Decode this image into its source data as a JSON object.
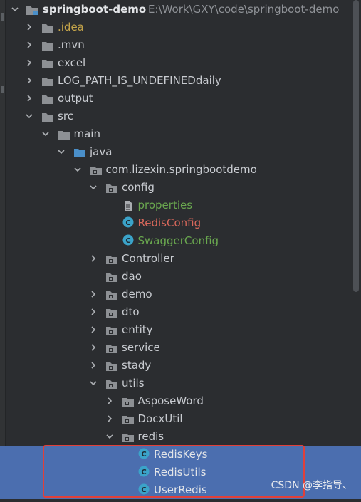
{
  "project": {
    "name": "springboot-demo",
    "path": "E:\\Work\\GXY\\code\\springboot-demo"
  },
  "tree": [
    {
      "label": ".idea",
      "kind": "folder",
      "color": "yellow",
      "arrow": "collapsed"
    },
    {
      "label": ".mvn",
      "kind": "folder",
      "color": "default",
      "arrow": "collapsed"
    },
    {
      "label": "excel",
      "kind": "folder",
      "color": "default",
      "arrow": "collapsed"
    },
    {
      "label": "LOG_PATH_IS_UNDEFINEDdaily",
      "kind": "folder",
      "color": "default",
      "arrow": "collapsed"
    },
    {
      "label": "output",
      "kind": "folder",
      "color": "default",
      "arrow": "collapsed"
    },
    {
      "label": "src",
      "kind": "folder",
      "color": "default",
      "arrow": "expanded"
    },
    {
      "label": "main",
      "kind": "folder",
      "color": "default",
      "arrow": "expanded"
    },
    {
      "label": "java",
      "kind": "source-folder",
      "color": "default",
      "arrow": "expanded"
    },
    {
      "label": "com.lizexin.springbootdemo",
      "kind": "package",
      "color": "default",
      "arrow": "expanded"
    },
    {
      "label": "config",
      "kind": "package",
      "color": "default",
      "arrow": "expanded"
    },
    {
      "label": "properties",
      "kind": "file",
      "color": "green",
      "arrow": "none"
    },
    {
      "label": "RedisConfig",
      "kind": "class",
      "color": "red",
      "arrow": "none"
    },
    {
      "label": "SwaggerConfig",
      "kind": "class",
      "color": "green",
      "arrow": "none"
    },
    {
      "label": "Controller",
      "kind": "package",
      "color": "default",
      "arrow": "collapsed"
    },
    {
      "label": "dao",
      "kind": "package",
      "color": "default",
      "arrow": "none"
    },
    {
      "label": "demo",
      "kind": "package",
      "color": "default",
      "arrow": "collapsed"
    },
    {
      "label": "dto",
      "kind": "package",
      "color": "default",
      "arrow": "collapsed"
    },
    {
      "label": "entity",
      "kind": "package",
      "color": "default",
      "arrow": "collapsed"
    },
    {
      "label": "service",
      "kind": "package",
      "color": "default",
      "arrow": "collapsed"
    },
    {
      "label": "stady",
      "kind": "package",
      "color": "default",
      "arrow": "collapsed"
    },
    {
      "label": "utils",
      "kind": "package",
      "color": "default",
      "arrow": "expanded"
    },
    {
      "label": "AsposeWord",
      "kind": "package",
      "color": "default",
      "arrow": "collapsed"
    },
    {
      "label": "DocxUtil",
      "kind": "package",
      "color": "default",
      "arrow": "collapsed"
    },
    {
      "label": "redis",
      "kind": "package",
      "color": "default",
      "arrow": "expanded"
    },
    {
      "label": "RedisKeys",
      "kind": "class",
      "color": "white",
      "arrow": "none",
      "selected": true
    },
    {
      "label": "RedisUtils",
      "kind": "class",
      "color": "white",
      "arrow": "none",
      "selected": true
    },
    {
      "label": "UserRedis",
      "kind": "class",
      "color": "white",
      "arrow": "none",
      "selected": true
    }
  ],
  "watermark": "CSDN @李指导、",
  "colors": {
    "background": "#2b2d30",
    "selection": "#4b6eaf",
    "highlight_border": "#e0403a",
    "folder": "#8d9094",
    "source_folder": "#4a8fc9",
    "class_icon": "#3ba3c9"
  }
}
